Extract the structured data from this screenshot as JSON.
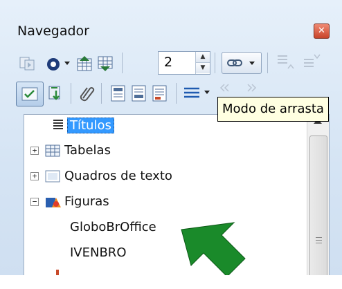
{
  "window": {
    "title": "Navegador",
    "close_glyph": "✕"
  },
  "toolbar1": {
    "spin_value": "2",
    "icons": [
      "navigation-toggle-icon",
      "navigate-circle-icon",
      "dropdown-arrow-icon",
      "previous-icon",
      "next-icon",
      "link-dropdown-icon",
      "promote-level-icon",
      "demote-level-icon"
    ]
  },
  "toolbar2": {
    "icons": [
      "drag-mode-icon",
      "headings-icon",
      "reminder-icon",
      "header-icon",
      "footer-icon",
      "anchor-icon",
      "heading-levels-icon",
      "promote-chapter-icon",
      "demote-chapter-icon"
    ]
  },
  "tooltip": {
    "text": "Modo de arrasta"
  },
  "tree": {
    "items": [
      {
        "label": "Títulos",
        "icon": "headings-icon",
        "selected": true
      },
      {
        "label": "Tabelas",
        "icon": "table-icon",
        "expander": "+"
      },
      {
        "label": "Quadros de texto",
        "icon": "frame-icon",
        "expander": "+"
      },
      {
        "label": "Figuras",
        "icon": "images-icon",
        "expander": "−"
      },
      {
        "label": "GloboBrOffice",
        "child": true
      },
      {
        "label": "IVENBRO",
        "child": true
      }
    ]
  },
  "colors": {
    "panel": "#dce8f6",
    "selection": "#3399ff",
    "arrow": "#1a8a2a",
    "tooltip_bg": "#ffffe1"
  }
}
